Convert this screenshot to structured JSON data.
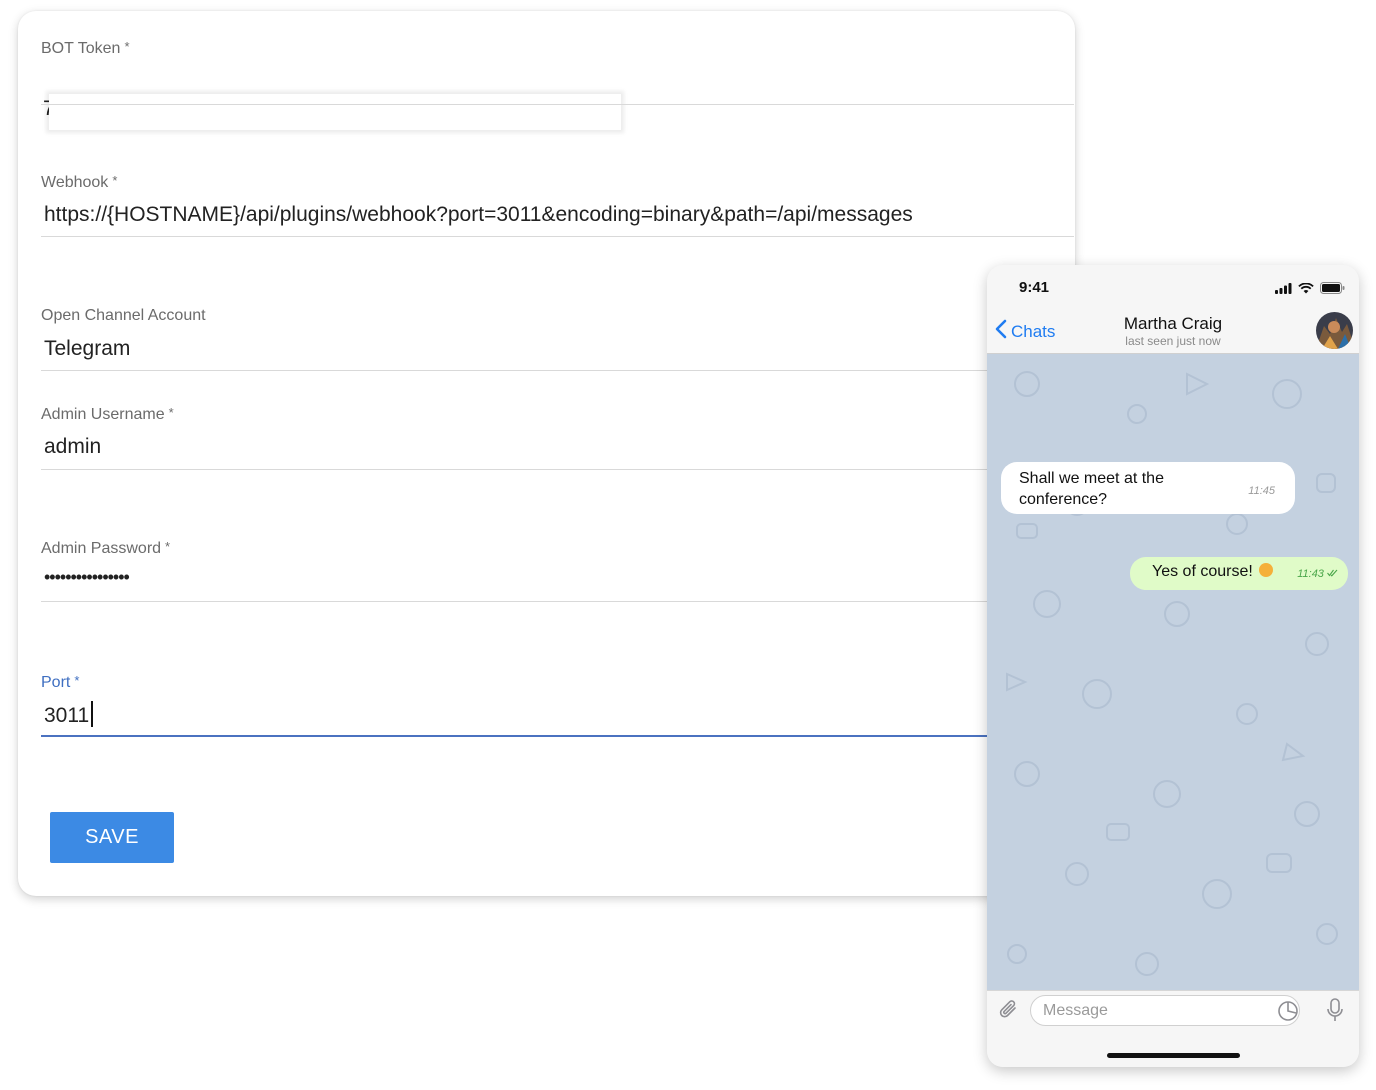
{
  "form": {
    "bot_token": {
      "label": "BOT Token",
      "required": "*",
      "value_visible": "7"
    },
    "webhook": {
      "label": "Webhook",
      "required": "*",
      "value": "https://{HOSTNAME}/api/plugins/webhook?port=3011&encoding=binary&path=/api/messages"
    },
    "open_channel": {
      "label": "Open Channel Account",
      "value": "Telegram"
    },
    "admin_username": {
      "label": "Admin Username",
      "required": "*",
      "value": "admin"
    },
    "admin_password": {
      "label": "Admin Password",
      "required": "*",
      "value": "••••••••••••••••"
    },
    "port": {
      "label": "Port",
      "required": "*",
      "value": "3011"
    },
    "save_label": "SAVE"
  },
  "phone": {
    "status_time": "9:41",
    "back_label": "Chats",
    "contact_name": "Martha Craig",
    "contact_status": "last seen just now",
    "messages": [
      {
        "direction": "incoming",
        "text": "Shall we meet at the conference?",
        "time": "11:45"
      },
      {
        "direction": "outgoing",
        "text": "Yes of course!",
        "time": "11:43"
      }
    ],
    "message_placeholder": "Message"
  },
  "colors": {
    "accent_blue": "#3c8ae4",
    "focus_blue": "#4b72c0",
    "telegram_blue": "#1f7cf1",
    "chat_background": "#c4d1e0",
    "outgoing_bubble": "#e0fbc8"
  },
  "icons": [
    "chevron-left-icon",
    "signal-icon",
    "wifi-icon",
    "battery-icon",
    "paperclip-icon",
    "sticker-icon",
    "microphone-icon",
    "double-check-icon",
    "emoji-icon"
  ]
}
